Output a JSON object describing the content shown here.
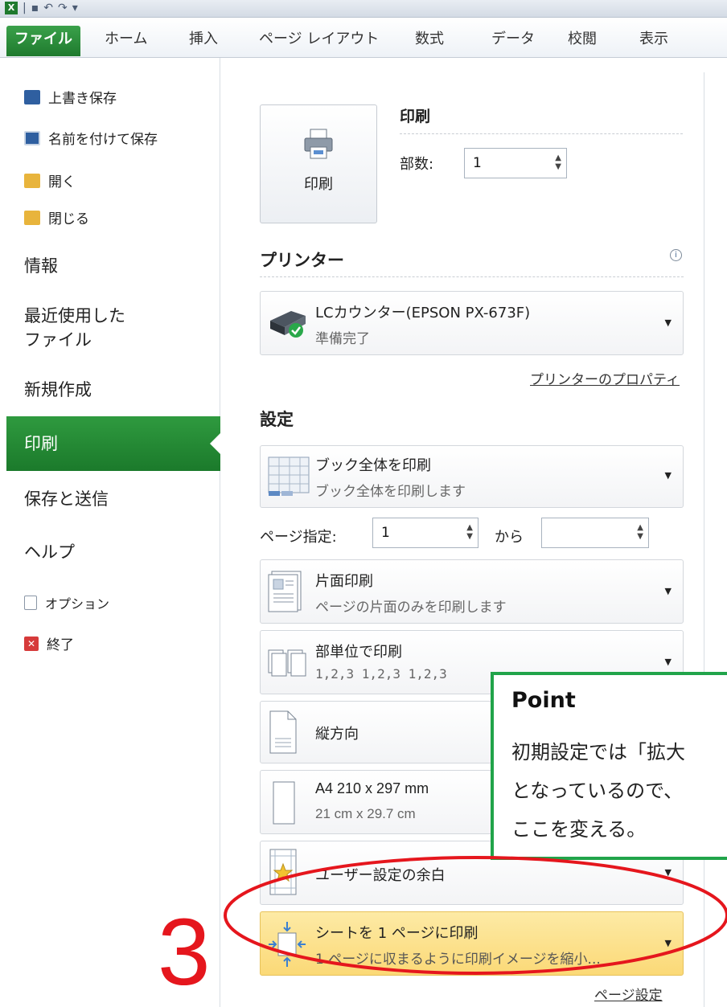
{
  "quick_access": {
    "icon_text": "X",
    "separator": "|"
  },
  "ribbon_tabs": [
    "ファイル",
    "ホーム",
    "挿入",
    "ページ レイアウト",
    "数式",
    "データ",
    "校閲",
    "表示"
  ],
  "sidebar": {
    "small_items": [
      "上書き保存",
      "名前を付けて保存",
      "開く",
      "閉じる"
    ],
    "big_items": [
      "情報",
      "最近使用した",
      "ファイル",
      "新規作成"
    ],
    "active": "印刷",
    "big_items_2": [
      "保存と送信",
      "ヘルプ"
    ],
    "bottom_items": [
      "オプション",
      "終了"
    ]
  },
  "print": {
    "button_label": "印刷",
    "heading": "印刷",
    "copies_label": "部数:",
    "copies_value": "1"
  },
  "printer": {
    "heading": "プリンター",
    "info_icon": "i",
    "name": "LCカウンター(EPSON PX-673F)",
    "status": "準備完了",
    "properties_link": "プリンターのプロパティ"
  },
  "settings": {
    "heading": "設定",
    "scope_title": "ブック全体を印刷",
    "scope_desc": "ブック全体を印刷します",
    "pages_label": "ページ指定:",
    "pages_from": "1",
    "pages_to_label": "から",
    "pages_to": "",
    "sides_title": "片面印刷",
    "sides_desc": "ページの片面のみを印刷します",
    "collate_title": "部単位で印刷",
    "collate_desc": "1,2,3   1,2,3   1,2,3",
    "orientation": "縦方向",
    "paper_title": "A4 210 x 297 mm",
    "paper_desc": "21 cm x 29.7 cm",
    "margins": "ユーザー設定の余白",
    "scaling_title": "シートを 1 ページに印刷",
    "scaling_desc": "1 ページに収まるように印刷イメージを縮小...",
    "page_setup_link": "ページ設定"
  },
  "callout": {
    "title": "Point",
    "lines": [
      "初期設定では「拡大",
      "となっているので、",
      "ここを変える。"
    ]
  },
  "annotation_number": "3",
  "colors": {
    "accent_green": "#1f7a2e",
    "callout_border": "#21a44a",
    "annotation_red": "#e5161d",
    "highlight": "#fbd977"
  }
}
